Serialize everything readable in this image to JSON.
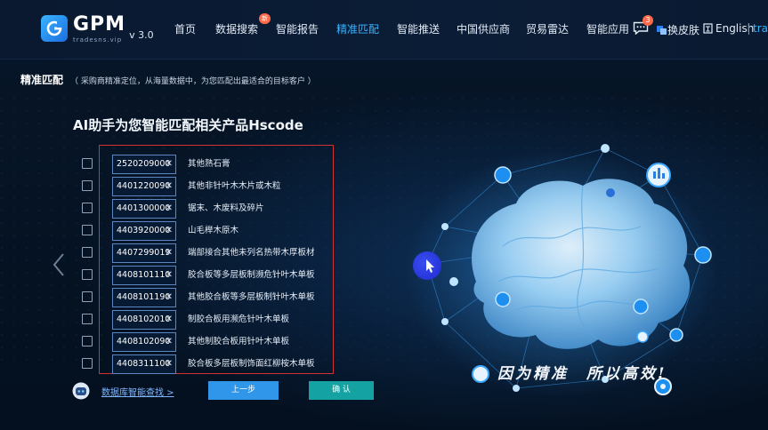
{
  "header": {
    "logo_name": "GPM",
    "logo_sub": "tradesns.vip",
    "version": "v 3.0",
    "nav": [
      {
        "label": "首页"
      },
      {
        "label": "数据搜索",
        "badge": "新"
      },
      {
        "label": "智能报告"
      },
      {
        "label": "精准匹配",
        "active": true
      },
      {
        "label": "智能推送"
      },
      {
        "label": "中国供应商"
      },
      {
        "label": "贸易雷达"
      },
      {
        "label": "智能应用"
      }
    ],
    "message_count": "3",
    "skin_label": "换皮肤",
    "lang_label": "English",
    "cut_label": "tra"
  },
  "page": {
    "title": "精准匹配",
    "description": "（ 采购商精准定位，从海量数据中，为您匹配出最适合的目标客户 ）",
    "headline": "AI助手为您智能匹配相关产品Hscode"
  },
  "products": [
    {
      "code": "2520209000",
      "name": "其他熟石膏"
    },
    {
      "code": "4401220090",
      "name": "其他非针叶木木片或木粒"
    },
    {
      "code": "4401300000",
      "name": "锯末、木废料及碎片"
    },
    {
      "code": "4403920000",
      "name": "山毛榉木原木"
    },
    {
      "code": "4407299019",
      "name": "端部接合其他未列名热带木厚板材"
    },
    {
      "code": "4408101110",
      "name": "胶合板等多层板制濒危针叶木单板"
    },
    {
      "code": "4408101190",
      "name": "其他胶合板等多层板制针叶木单板"
    },
    {
      "code": "4408102010",
      "name": "制胶合板用濒危针叶木单板"
    },
    {
      "code": "4408102090",
      "name": "其他制胶合板用针叶木单板"
    },
    {
      "code": "4408311100",
      "name": "胶合板多层板制饰面红柳桉木单板"
    }
  ],
  "remove_glyph": "✕",
  "footer": {
    "db_link": "数据库智能查找 >",
    "prev_button": "上一步",
    "confirm_button": "确 认"
  },
  "slogan": "因为精准　所以高效!",
  "colors": {
    "accent": "#36b4ff",
    "background": "#04101f",
    "prev_button": "#2f96ea",
    "confirm_button": "#14a2a3",
    "highlight_border": "#d33232"
  }
}
